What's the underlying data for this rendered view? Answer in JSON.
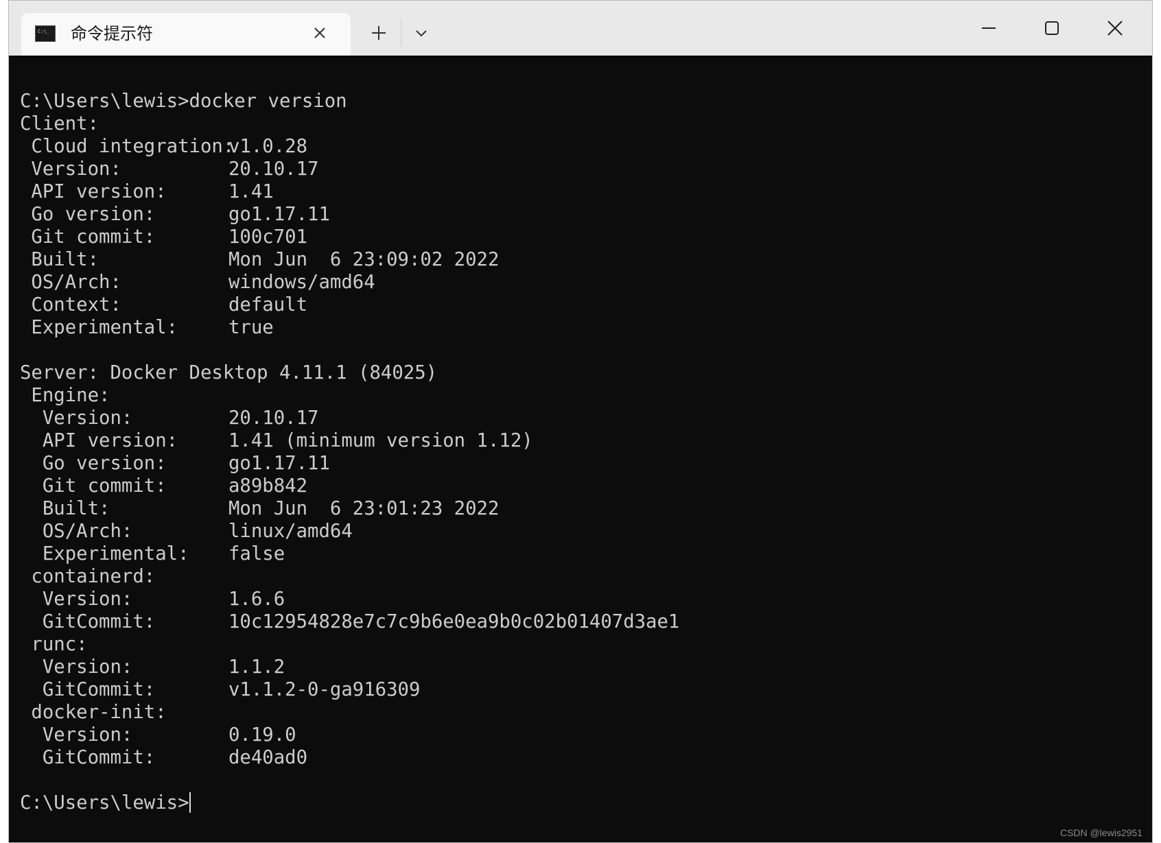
{
  "tab": {
    "title": "命令提示符"
  },
  "terminal": {
    "command_line": "C:\\Users\\lewis>docker version",
    "client_header": "Client:",
    "client": [
      {
        "key": " Cloud integration:",
        "value": "v1.0.28"
      },
      {
        "key": " Version:",
        "value": "20.10.17"
      },
      {
        "key": " API version:",
        "value": "1.41"
      },
      {
        "key": " Go version:",
        "value": "go1.17.11"
      },
      {
        "key": " Git commit:",
        "value": "100c701"
      },
      {
        "key": " Built:",
        "value": "Mon Jun  6 23:09:02 2022"
      },
      {
        "key": " OS/Arch:",
        "value": "windows/amd64"
      },
      {
        "key": " Context:",
        "value": "default"
      },
      {
        "key": " Experimental:",
        "value": "true"
      }
    ],
    "server_header": "Server: Docker Desktop 4.11.1 (84025)",
    "engine_header": " Engine:",
    "engine": [
      {
        "key": "  Version:",
        "value": "20.10.17"
      },
      {
        "key": "  API version:",
        "value": "1.41 (minimum version 1.12)"
      },
      {
        "key": "  Go version:",
        "value": "go1.17.11"
      },
      {
        "key": "  Git commit:",
        "value": "a89b842"
      },
      {
        "key": "  Built:",
        "value": "Mon Jun  6 23:01:23 2022"
      },
      {
        "key": "  OS/Arch:",
        "value": "linux/amd64"
      },
      {
        "key": "  Experimental:",
        "value": "false"
      }
    ],
    "containerd_header": " containerd:",
    "containerd": [
      {
        "key": "  Version:",
        "value": "1.6.6"
      },
      {
        "key": "  GitCommit:",
        "value": "10c12954828e7c7c9b6e0ea9b0c02b01407d3ae1"
      }
    ],
    "runc_header": " runc:",
    "runc": [
      {
        "key": "  Version:",
        "value": "1.1.2"
      },
      {
        "key": "  GitCommit:",
        "value": "v1.1.2-0-ga916309"
      }
    ],
    "dockerinit_header": " docker-init:",
    "dockerinit": [
      {
        "key": "  Version:",
        "value": "0.19.0"
      },
      {
        "key": "  GitCommit:",
        "value": "de40ad0"
      }
    ],
    "prompt": "C:\\Users\\lewis>"
  },
  "watermark": "CSDN @lewis2951",
  "colors": {
    "terminal_bg": "#0c0c0c",
    "terminal_fg": "#cccccc",
    "titlebar_bg": "#e9e9e9",
    "tab_bg": "#f9f9f9"
  },
  "icons": {
    "tab_icon": "cmd-icon",
    "close": "close-icon",
    "new_tab": "plus-icon",
    "dropdown": "chevron-down-icon",
    "minimize": "minimize-icon",
    "maximize": "maximize-icon",
    "window_close": "window-close-icon"
  }
}
